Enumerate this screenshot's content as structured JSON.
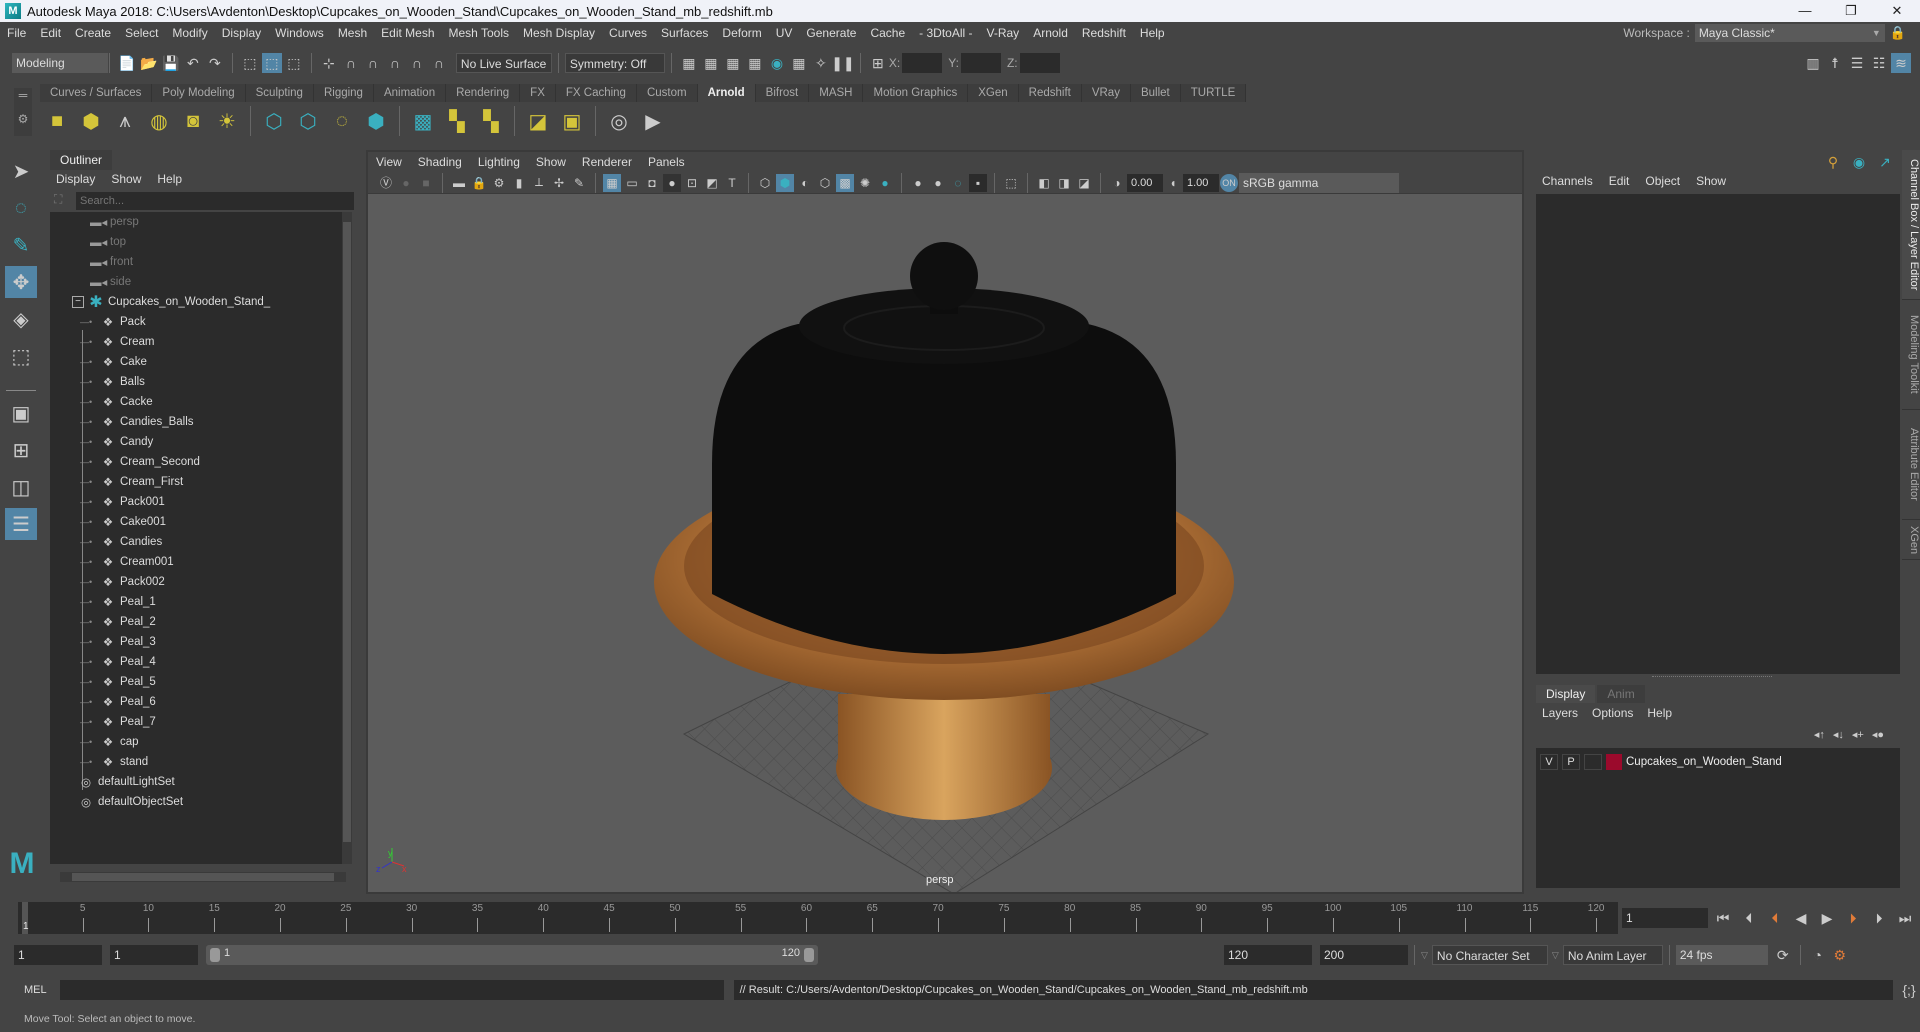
{
  "window": {
    "title": "Autodesk Maya 2018: C:\\Users\\Avdenton\\Desktop\\Cupcakes_on_Wooden_Stand\\Cupcakes_on_Wooden_Stand_mb_redshift.mb",
    "app_icon": "M",
    "controls": {
      "minimize": "—",
      "maximize": "❐",
      "close": "✕"
    }
  },
  "menubar": {
    "items": [
      "File",
      "Edit",
      "Create",
      "Select",
      "Modify",
      "Display",
      "Windows",
      "Mesh",
      "Edit Mesh",
      "Mesh Tools",
      "Mesh Display",
      "Curves",
      "Surfaces",
      "Deform",
      "UV",
      "Generate",
      "Cache",
      "- 3DtoAll -",
      "V-Ray",
      "Arnold",
      "Redshift",
      "Help"
    ],
    "workspace_label": "Workspace :",
    "workspace_value": "Maya Classic*"
  },
  "status_line": {
    "mode": "Modeling",
    "live_surface": "No Live Surface",
    "symmetry": "Symmetry: Off",
    "x_label": "X:",
    "y_label": "Y:",
    "z_label": "Z:"
  },
  "shelf": {
    "tabs": [
      "Curves / Surfaces",
      "Poly Modeling",
      "Sculpting",
      "Rigging",
      "Animation",
      "Rendering",
      "FX",
      "FX Caching",
      "Custom",
      "Arnold",
      "Bifrost",
      "MASH",
      "Motion Graphics",
      "XGen",
      "Redshift",
      "VRay",
      "Bullet",
      "TURTLE"
    ],
    "active_tab": "Arnold"
  },
  "outliner": {
    "title": "Outliner",
    "menu": [
      "Display",
      "Show",
      "Help"
    ],
    "search_placeholder": "Search...",
    "cameras": [
      "persp",
      "top",
      "front",
      "side"
    ],
    "root": "Cupcakes_on_Wooden_Stand_",
    "children": [
      "Pack",
      "Cream",
      "Cake",
      "Balls",
      "Cacke",
      "Candies_Balls",
      "Candy",
      "Cream_Second",
      "Cream_First",
      "Pack001",
      "Cake001",
      "Candies",
      "Cream001",
      "Pack002",
      "Peal_1",
      "Peal_2",
      "Peal_3",
      "Peal_4",
      "Peal_5",
      "Peal_6",
      "Peal_7",
      "cap",
      "stand"
    ],
    "sets": [
      "defaultLightSet",
      "defaultObjectSet"
    ]
  },
  "viewport": {
    "menu": [
      "View",
      "Shading",
      "Lighting",
      "Show",
      "Renderer",
      "Panels"
    ],
    "exposure": "0.00",
    "gamma": "1.00",
    "color_space": "sRGB gamma",
    "camera_label": "persp",
    "axis": {
      "x": "x",
      "y": "y",
      "z": "z"
    }
  },
  "channel_box": {
    "menu": [
      "Channels",
      "Edit",
      "Object",
      "Show"
    ],
    "layer_tabs": [
      "Display",
      "Anim"
    ],
    "active_layer_tab": "Display",
    "layer_menu": [
      "Layers",
      "Options",
      "Help"
    ],
    "layers": [
      {
        "v": "V",
        "p": "P",
        "color": "#9b0a2c",
        "name": "Cupcakes_on_Wooden_Stand"
      }
    ]
  },
  "side_tabs": [
    "Channel Box / Layer Editor",
    "Modeling Toolkit",
    "Attribute Editor",
    "XGen"
  ],
  "timeline": {
    "ticks": [
      5,
      10,
      15,
      20,
      25,
      30,
      35,
      40,
      45,
      50,
      55,
      60,
      65,
      70,
      75,
      80,
      85,
      90,
      95,
      100,
      105,
      110,
      115,
      120
    ],
    "range_min": 1,
    "range_max": 120,
    "current_frame": "1",
    "current_frame_field": "1"
  },
  "range": {
    "start": "1",
    "playback_start": "1",
    "slider_start": "1",
    "slider_end": "120",
    "playback_end": "120",
    "end": "200",
    "character_set": "No Character Set",
    "anim_layer": "No Anim Layer",
    "fps": "24 fps"
  },
  "command_line": {
    "lang": "MEL",
    "input": "",
    "result": "// Result: C:/Users/Avdenton/Desktop/Cupcakes_on_Wooden_Stand/Cupcakes_on_Wooden_Stand_mb_redshift.mb"
  },
  "help_line": "Move Tool: Select an object to move.",
  "colors": {
    "accent": "#5285a6",
    "layer_color": "#9b0a2c",
    "current_frame_marker": "#e07b39"
  }
}
